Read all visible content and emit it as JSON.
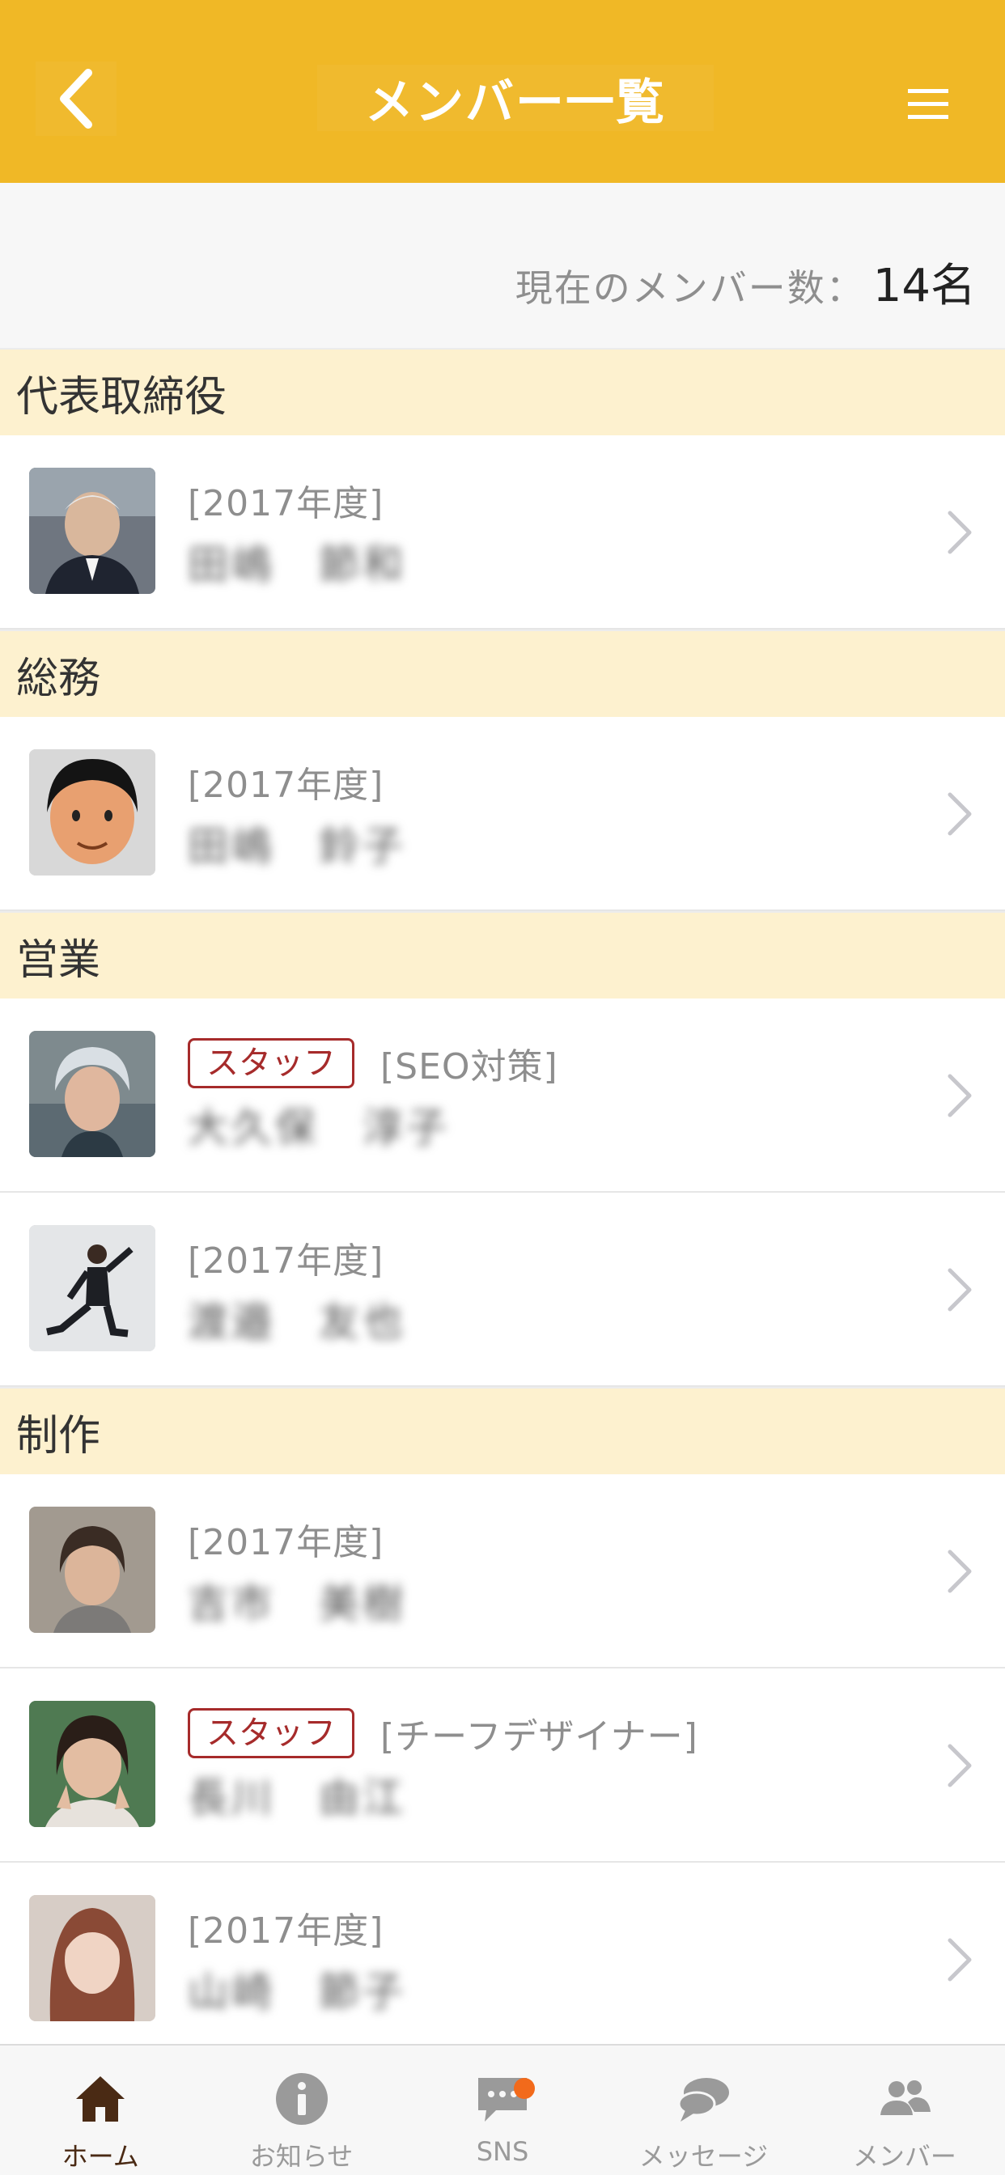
{
  "header": {
    "title": "メンバー一覧",
    "back_icon": "chevron-left-icon",
    "menu_icon": "hamburger-menu-icon",
    "color": "#f0b826"
  },
  "member_count": {
    "label": "現在のメンバー数：",
    "value": "14名"
  },
  "badge_label": "スタッフ",
  "sections": [
    {
      "title": "代表取締役",
      "members": [
        {
          "meta": "[2017年度]",
          "name": "田嶋　節和",
          "staff": false
        }
      ]
    },
    {
      "title": "総務",
      "members": [
        {
          "meta": "[2017年度]",
          "name": "田嶋　鈴子",
          "staff": false
        }
      ]
    },
    {
      "title": "営業",
      "members": [
        {
          "meta": "[SEO対策]",
          "name": "大久保　淳子",
          "staff": true
        },
        {
          "meta": "[2017年度]",
          "name": "渡邉　友也",
          "staff": false
        }
      ]
    },
    {
      "title": "制作",
      "members": [
        {
          "meta": "[2017年度]",
          "name": "吉市　美樹",
          "staff": false
        },
        {
          "meta": "[チーフデザイナー]",
          "name": "長川　由江",
          "staff": true
        },
        {
          "meta": "[2017年度]",
          "name": "山崎　節子",
          "staff": false
        }
      ]
    }
  ],
  "tabs": [
    {
      "label": "ホーム",
      "icon": "home-icon",
      "active": true
    },
    {
      "label": "お知らせ",
      "icon": "info-icon",
      "active": false
    },
    {
      "label": "SNS",
      "icon": "chat-bubble-icon",
      "active": false,
      "notification": true
    },
    {
      "label": "メッセージ",
      "icon": "speech-bubbles-icon",
      "active": false
    },
    {
      "label": "メンバー",
      "icon": "people-icon",
      "active": false
    }
  ],
  "colors": {
    "accent": "#f0b826",
    "section_bg": "#fdf1cf",
    "badge": "#a62b2b",
    "active_tab": "#4a2a14",
    "notification": "#f26a1b"
  }
}
